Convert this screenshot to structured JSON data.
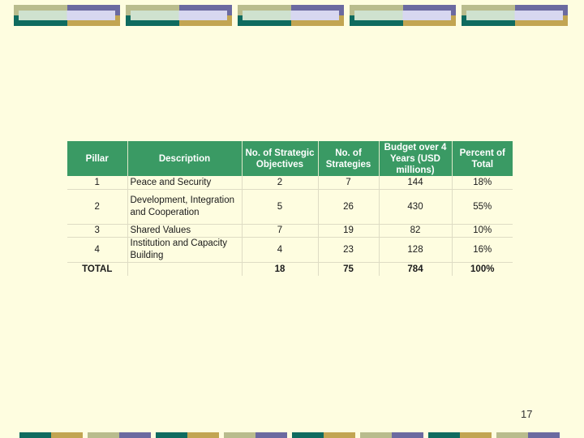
{
  "colors": {
    "background": "#fefde0",
    "header_fill": "#3a9a64",
    "deco_olive": "#b9bc8d",
    "deco_purple": "#6b6aa0",
    "deco_teal": "#0f6b5f",
    "deco_gold": "#c2a552"
  },
  "table": {
    "headers": {
      "pillar": "Pillar",
      "description": "Description",
      "objectives": "No. of Strategic Objectives",
      "strategies": "No. of Strategies",
      "budget": "Budget over 4 Years (USD millions)",
      "percent": "Percent of Total"
    },
    "rows": [
      {
        "pillar": "1",
        "description": "Peace and Security",
        "objectives": "2",
        "strategies": "7",
        "budget": "144",
        "percent": "18%"
      },
      {
        "pillar": "2",
        "description": "Development, Integration and Cooperation",
        "objectives": "5",
        "strategies": "26",
        "budget": "430",
        "percent": "55%"
      },
      {
        "pillar": "3",
        "description": "Shared Values",
        "objectives": "7",
        "strategies": "19",
        "budget": "82",
        "percent": "10%"
      },
      {
        "pillar": "4",
        "description": "Institution and Capacity Building",
        "objectives": "4",
        "strategies": "23",
        "budget": "128",
        "percent": "16%"
      }
    ],
    "total": {
      "label": "TOTAL",
      "objectives": "18",
      "strategies": "75",
      "budget": "784",
      "percent": "100%"
    }
  },
  "page_number": "17"
}
